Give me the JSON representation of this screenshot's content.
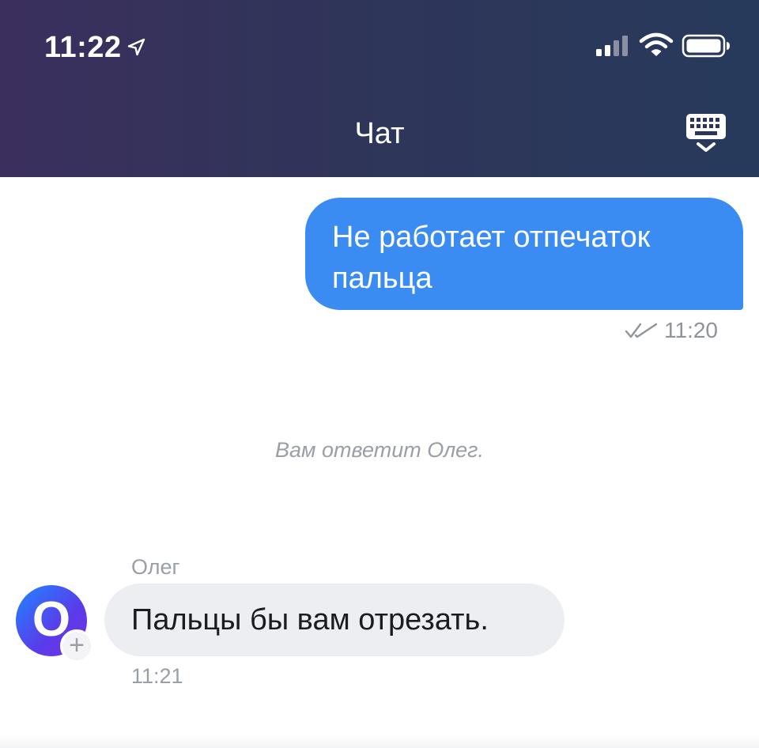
{
  "status_bar": {
    "time": "11:22",
    "location_icon": "location-arrow-icon",
    "signal_icon": "cellular-signal-icon",
    "wifi_icon": "wifi-icon",
    "battery_icon": "battery-icon"
  },
  "header": {
    "title": "Чат",
    "keyboard_icon": "keyboard-hide-icon",
    "background_colors": [
      "#3b2f5e",
      "#273a5c"
    ]
  },
  "messages": [
    {
      "direction": "outgoing",
      "text": "Не работает отпечаток пальца",
      "time": "11:20",
      "status_icon": "double-check-icon",
      "bubble_color": "#3a8cf2"
    },
    {
      "direction": "system",
      "text": "Вам ответит Олег."
    },
    {
      "direction": "incoming",
      "sender": "Олег",
      "avatar_letter": "O",
      "avatar_badge": "+",
      "text": "Пальцы бы вам отрезать.",
      "time": "11:21",
      "bubble_color": "#eceef1"
    }
  ]
}
